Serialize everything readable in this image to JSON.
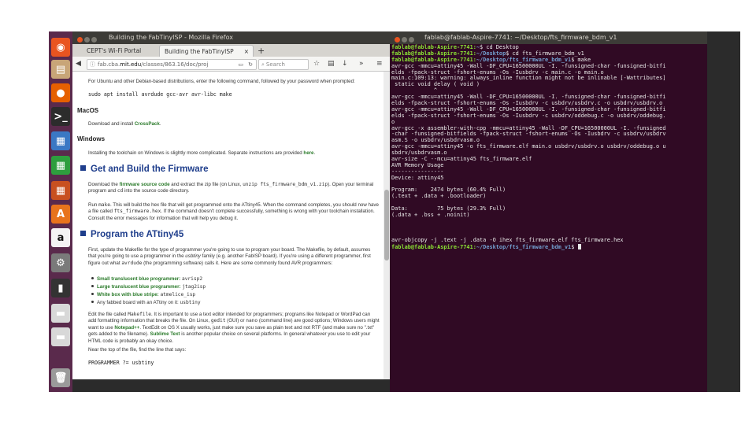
{
  "launcher": {
    "items": [
      {
        "name": "ubuntu-dash-icon",
        "glyph": "◉",
        "bg": "#e95420"
      },
      {
        "name": "files-icon",
        "glyph": "▤",
        "bg": "#c8a578"
      },
      {
        "name": "firefox-icon",
        "glyph": "●",
        "bg": "#e66000"
      },
      {
        "name": "terminal-icon",
        "glyph": ">_",
        "bg": "#2c2c2c"
      },
      {
        "name": "writer-icon",
        "glyph": "▦",
        "bg": "#3a78c4"
      },
      {
        "name": "calc-icon",
        "glyph": "▦",
        "bg": "#2e9e3e"
      },
      {
        "name": "impress-icon",
        "glyph": "▦",
        "bg": "#c85020"
      },
      {
        "name": "software-center-icon",
        "glyph": "A",
        "bg": "#e8731c"
      },
      {
        "name": "amazon-icon",
        "glyph": "a",
        "bg": "#f4f4f4"
      },
      {
        "name": "settings-icon",
        "glyph": "⚙",
        "bg": "#7a7a7a"
      },
      {
        "name": "usb-drive-icon",
        "glyph": "▮",
        "bg": "#333333"
      },
      {
        "name": "drive-icon",
        "glyph": "▬",
        "bg": "#d8d8d8"
      },
      {
        "name": "drive-icon-2",
        "glyph": "▬",
        "bg": "#d8d8d8"
      },
      {
        "name": "trash-icon",
        "glyph": "🗑",
        "bg": "#9a9a9a"
      }
    ]
  },
  "firefox": {
    "window_title": "Building the FabTinyISP - Mozilla Firefox",
    "tabs": [
      "CEPT's Wi-Fi Portal",
      "Building the FabTinyISP"
    ],
    "url_prefix": "fab.cba.",
    "url_domain": "mit.edu",
    "url_suffix": "/classes/863.16/doc/proj",
    "search_placeholder": "Search",
    "content": {
      "ubuntu_intro": "For Ubuntu and other Debian-based distributions, enter the following command, followed by your password when prompted:",
      "ubuntu_cmd": "sudo apt install avrdude gcc-avr avr-libc make",
      "macos_heading": "MacOS",
      "macos_text": "Download and install ",
      "macos_link": "CrossPack",
      "windows_heading": "Windows",
      "windows_text": "Installing the toolchain on Windows is slightly more complicated. Separate instructions are provided ",
      "windows_link": "here",
      "h_build": "Get and Build the Firmware",
      "build_p1a": "Download the ",
      "build_p1_link": "firmware source code",
      "build_p1b": " and extract the zip file (on Linux, ",
      "build_p1_code": "unzip fts_firmware_bdm_v1.zip",
      "build_p1c": "). Open your terminal program and ",
      "build_p1_cd": "cd",
      "build_p1d": " into the source code directory.",
      "build_p2a": "Run ",
      "build_p2_make": "make",
      "build_p2b": ". This will build the hex file that will get programmed onto the ATtiny45. When the command completes, you should now have a file called ",
      "build_p2_file": "fts_firmware.hex",
      "build_p2c": ". If the command doesn't complete successfully, something is wrong with your toolchain installation. Consult the error messages for information that will help you debug it.",
      "h_program": "Program the ATtiny45",
      "prog_p1a": "First, update the Makefile for the type of programmer you're going to use to program your board. The Makefile, by default, assumes that you're going to use a programmer in the ",
      "prog_p1_it": "usbtiny",
      "prog_p1b": " family (e.g. another FabISP board). If you're using a different programmer, first figure out what ",
      "prog_p1_code": "avrdude",
      "prog_p1c": " (the programming software) calls it. Here are some commonly found AVR programmers:",
      "bullets": [
        {
          "label": "Small translucent blue programmer:",
          "code": "avrisp2"
        },
        {
          "label": "Large translucent blue programmer:",
          "code": "jtag2isp"
        },
        {
          "label": "White box with blue stripe:",
          "code": "atmelice_isp"
        },
        {
          "label": "Any fabbed board with an ATtiny on it:",
          "code": "usbtiny"
        }
      ],
      "edit_p_a": "Edit the file called ",
      "edit_p_file": "Makefile",
      "edit_p_b": ". It is important to use a text editor intended for programmers; programs like Notepad or WordPad can add formatting information that breaks the file. On Linux, ",
      "edit_p_gedit": "gedit",
      "edit_p_c": " (GUI) or ",
      "edit_p_nano": "nano",
      "edit_p_d": " (command line) are good options; Windows users might want to use ",
      "edit_p_npp": "Notepad++",
      "edit_p_e": ". TextEdit on OS X usually works, just make sure you save as plain text and not RTF (and make sure no \".txt\" gets added to the filename). ",
      "edit_p_sublime": "Sublime Text",
      "edit_p_f": " is another popular choice on several platforms. In general whatever you use to edit your HTML code is probably an okay choice.",
      "near_top": "Near the top of the file, find the line that says:",
      "programmer_line": "PROGRAMMER ?= usbtiny"
    }
  },
  "terminal": {
    "window_title": "fablab@fablab-Aspire-7741: ~/Desktop/fts_firmware_bdm_v1",
    "lines": [
      {
        "prompt_user": "fablab@fablab-Aspire-7741",
        "prompt_path": "~",
        "cmd": " cd Desktop"
      },
      {
        "prompt_user": "fablab@fablab-Aspire-7741",
        "prompt_path": "~/Desktop",
        "cmd": " cd fts_firmware_bdm_v1"
      },
      {
        "prompt_user": "fablab@fablab-Aspire-7741",
        "prompt_path": "~/Desktop/fts_firmware_bdm_v1",
        "cmd": " make"
      },
      {
        "text": "avr-gcc -mmcu=attiny45 -Wall -DF_CPU=16500000UL -I. -funsigned-char -funsigned-bitfi"
      },
      {
        "text": "elds -fpack-struct -fshort-enums -Os -Iusbdrv -c main.c -o main.o"
      },
      {
        "text": "main.c:109:13: warning: always_inline function might not be inlinable [-Wattributes]"
      },
      {
        "text": " static void delay ( void )"
      },
      {
        "text": "             ^"
      },
      {
        "text": "avr-gcc -mmcu=attiny45 -Wall -DF_CPU=16500000UL -I. -funsigned-char -funsigned-bitfi"
      },
      {
        "text": "elds -fpack-struct -fshort-enums -Os -Iusbdrv -c usbdrv/usbdrv.c -o usbdrv/usbdrv.o"
      },
      {
        "text": "avr-gcc -mmcu=attiny45 -Wall -DF_CPU=16500000UL -I. -funsigned-char -funsigned-bitfi"
      },
      {
        "text": "elds -fpack-struct -fshort-enums -Os -Iusbdrv -c usbdrv/oddebug.c -o usbdrv/oddebug."
      },
      {
        "text": "o"
      },
      {
        "text": "avr-gcc -x assembler-with-cpp -mmcu=attiny45 -Wall -DF_CPU=16500000UL -I. -funsigned"
      },
      {
        "text": "-char -funsigned-bitfields -fpack-struct -fshort-enums -Os -Iusbdrv -c usbdrv/usbdrv"
      },
      {
        "text": "asm.S -o usbdrv/usbdrvasm.o"
      },
      {
        "text": "avr-gcc -mmcu=attiny45 -o fts_firmware.elf main.o usbdrv/usbdrv.o usbdrv/oddebug.o u"
      },
      {
        "text": "sbdrv/usbdrvasm.o"
      },
      {
        "text": "avr-size -C --mcu=attiny45 fts_firmware.elf"
      },
      {
        "text": "AVR Memory Usage"
      },
      {
        "text": "----------------"
      },
      {
        "text": "Device: attiny45"
      },
      {
        "text": ""
      },
      {
        "text": "Program:    2474 bytes (60.4% Full)"
      },
      {
        "text": "(.text + .data + .bootloader)"
      },
      {
        "text": ""
      },
      {
        "text": "Data:         75 bytes (29.3% Full)"
      },
      {
        "text": "(.data + .bss + .noinit)"
      },
      {
        "text": ""
      },
      {
        "text": ""
      },
      {
        "text": ""
      },
      {
        "text": "avr-objcopy -j .text -j .data -O ihex fts_firmware.elf fts_firmware.hex"
      },
      {
        "prompt_user": "fablab@fablab-Aspire-7741",
        "prompt_path": "~/Desktop/fts_firmware_bdm_v1",
        "cmd": " ",
        "cursor": true
      }
    ]
  },
  "colors": {
    "launcher_bg": "#5a2a4c",
    "terminal_bg": "#300a24",
    "heading_blue": "#1f3e8c",
    "link_green": "#2a7a2a",
    "prompt_green": "#8ae234",
    "prompt_blue": "#729fcf"
  }
}
